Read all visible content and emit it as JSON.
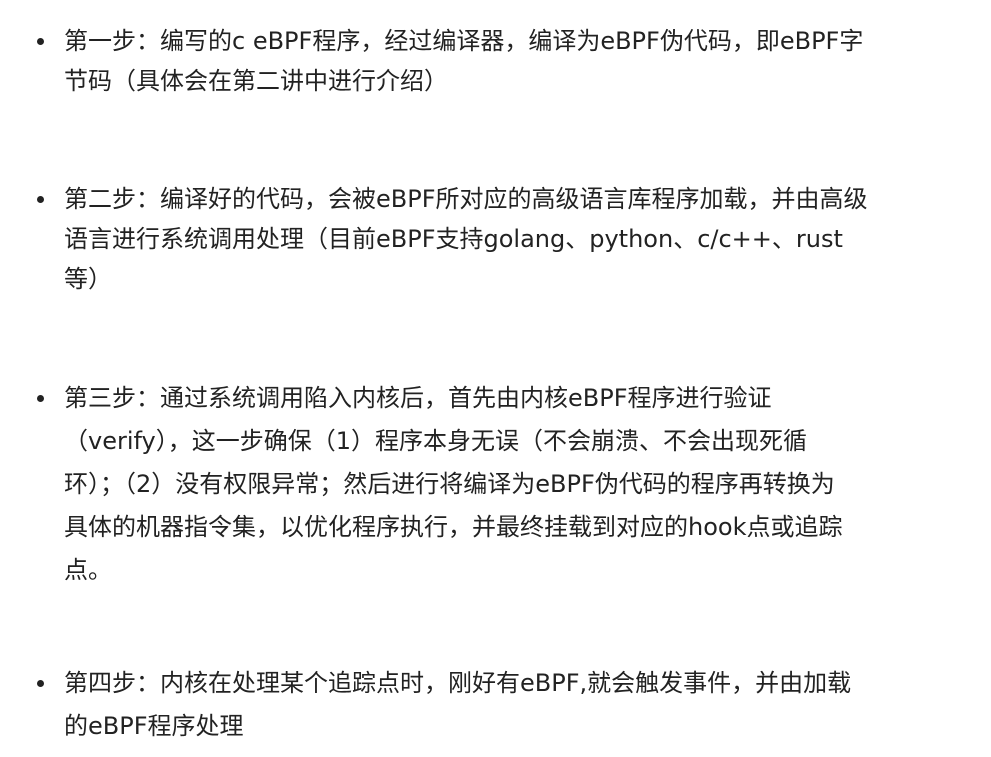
{
  "steps": [
    {
      "lines": [
        "第一步：编写的c eBPF程序，经过编译器，编译为eBPF伪代码，即eBPF字",
        "节码（具体会在第二讲中进行介绍）"
      ]
    },
    {
      "lines": [
        "第二步：编译好的代码，会被eBPF所对应的高级语言库程序加载，并由高级",
        "语言进行系统调用处理（目前eBPF支持golang、python、c/c++、rust",
        "等）"
      ]
    },
    {
      "lines": [
        "第三步：通过系统调用陷入内核后，首先由内核eBPF程序进行验证",
        "（verify），这一步确保（1）程序本身无误（不会崩溃、不会出现死循",
        "环）；（2）没有权限异常；然后进行将编译为eBPF伪代码的程序再转换为",
        "具体的机器指令集，以优化程序执行，并最终挂载到对应的hook点或追踪",
        "点。"
      ]
    },
    {
      "lines": [
        "第四步：内核在处理某个追踪点时，刚好有eBPF,就会触发事件，并由加载",
        "的eBPF程序处理"
      ]
    }
  ]
}
